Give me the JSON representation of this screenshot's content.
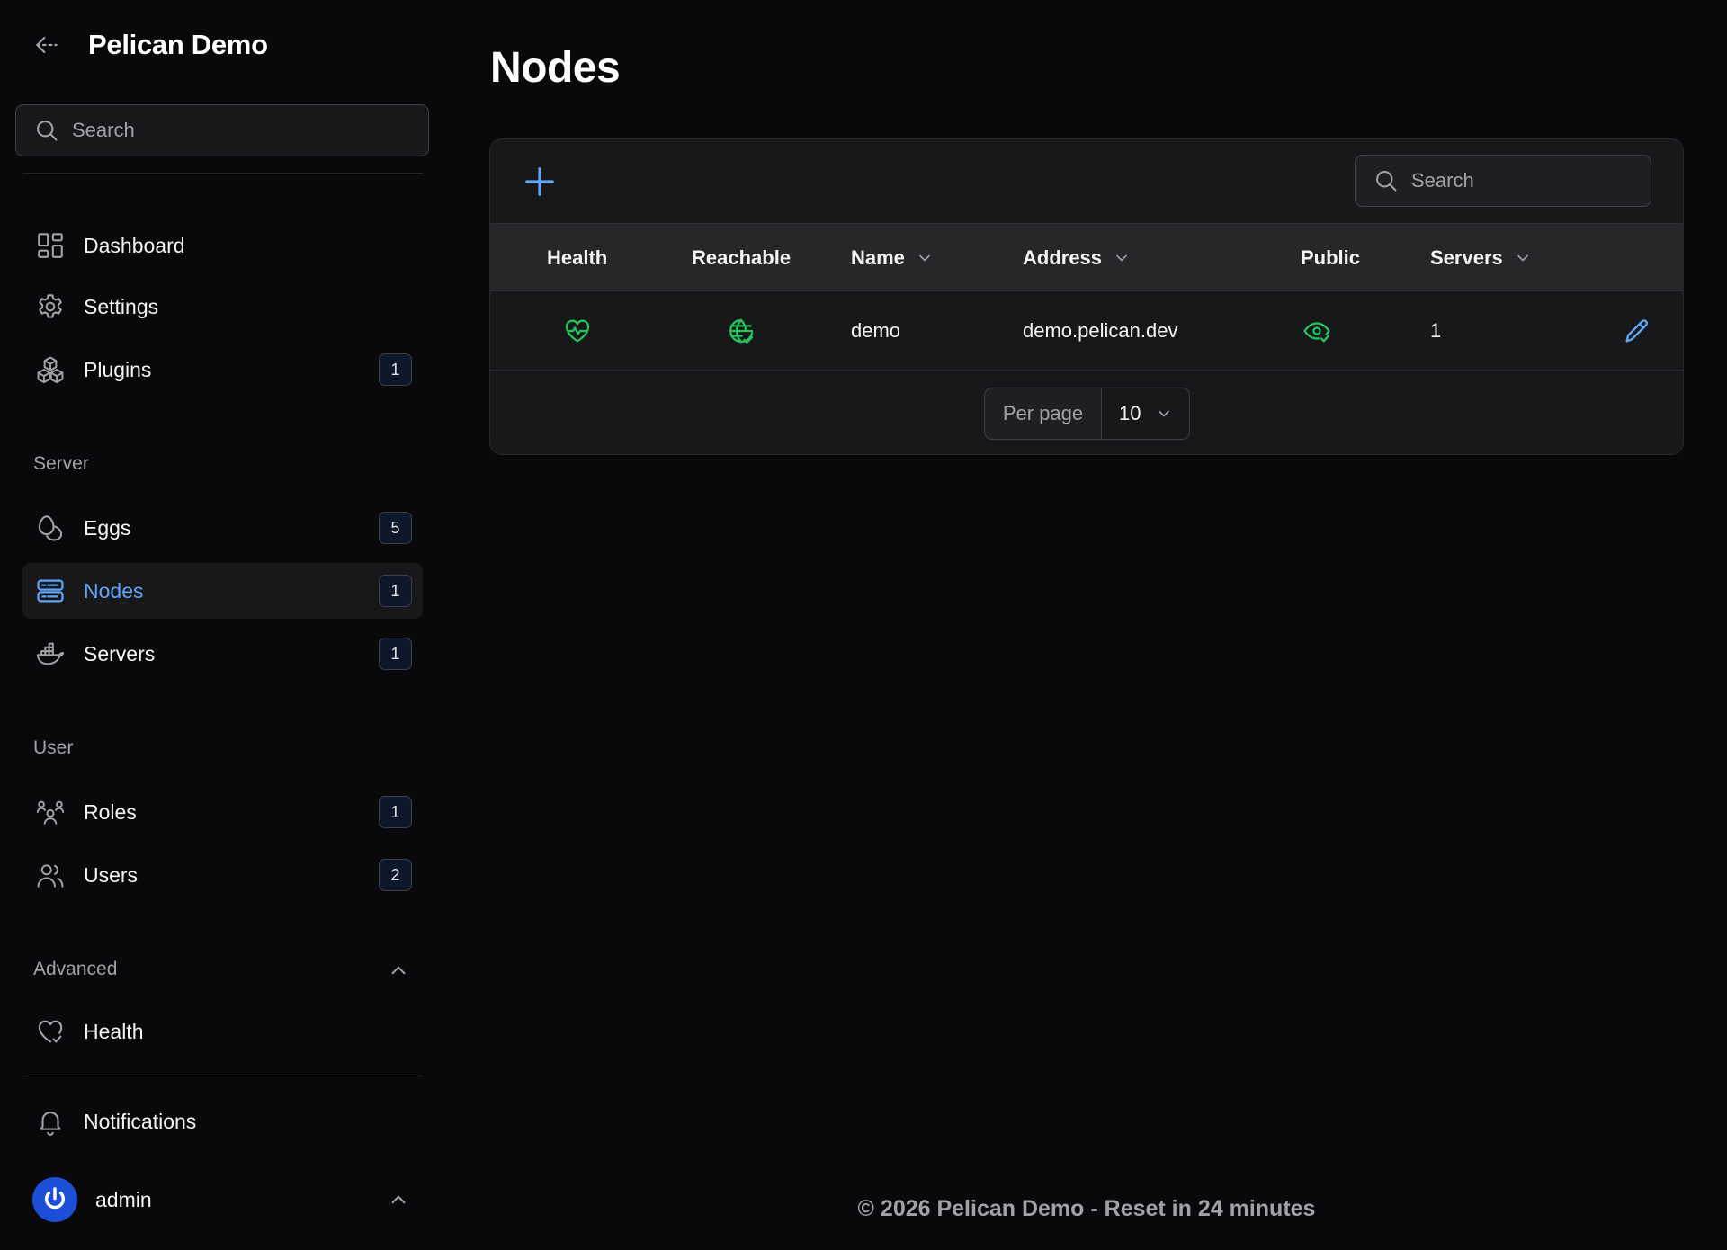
{
  "app": {
    "title": "Pelican Demo"
  },
  "sidebar": {
    "search_placeholder": "Search",
    "items": [
      {
        "label": "Dashboard"
      },
      {
        "label": "Settings"
      },
      {
        "label": "Plugins",
        "badge": "1"
      }
    ],
    "groups": {
      "server": {
        "label": "Server",
        "items": [
          {
            "label": "Eggs",
            "badge": "5"
          },
          {
            "label": "Nodes",
            "badge": "1",
            "active": true
          },
          {
            "label": "Servers",
            "badge": "1"
          }
        ]
      },
      "user": {
        "label": "User",
        "items": [
          {
            "label": "Roles",
            "badge": "1"
          },
          {
            "label": "Users",
            "badge": "2"
          }
        ]
      },
      "advanced": {
        "label": "Advanced",
        "items": [
          {
            "label": "Health"
          }
        ]
      }
    },
    "notifications": "Notifications",
    "user": "admin"
  },
  "main": {
    "page_title": "Nodes",
    "table": {
      "search_placeholder": "Search",
      "columns": {
        "health": "Health",
        "reachable": "Reachable",
        "name": "Name",
        "address": "Address",
        "public": "Public",
        "servers": "Servers"
      },
      "rows": [
        {
          "health": "healthy",
          "reachable": "reachable",
          "name": "demo",
          "address": "demo.pelican.dev",
          "public": "public",
          "servers": "1"
        }
      ],
      "pagination": {
        "per_page_label": "Per page",
        "per_page_value": "10"
      }
    },
    "footer": "© 2026 Pelican Demo - Reset in 24 minutes"
  },
  "colors": {
    "accent": "#60a5fa",
    "success": "#22c55e",
    "background": "#09090b",
    "surface": "#18181b"
  }
}
